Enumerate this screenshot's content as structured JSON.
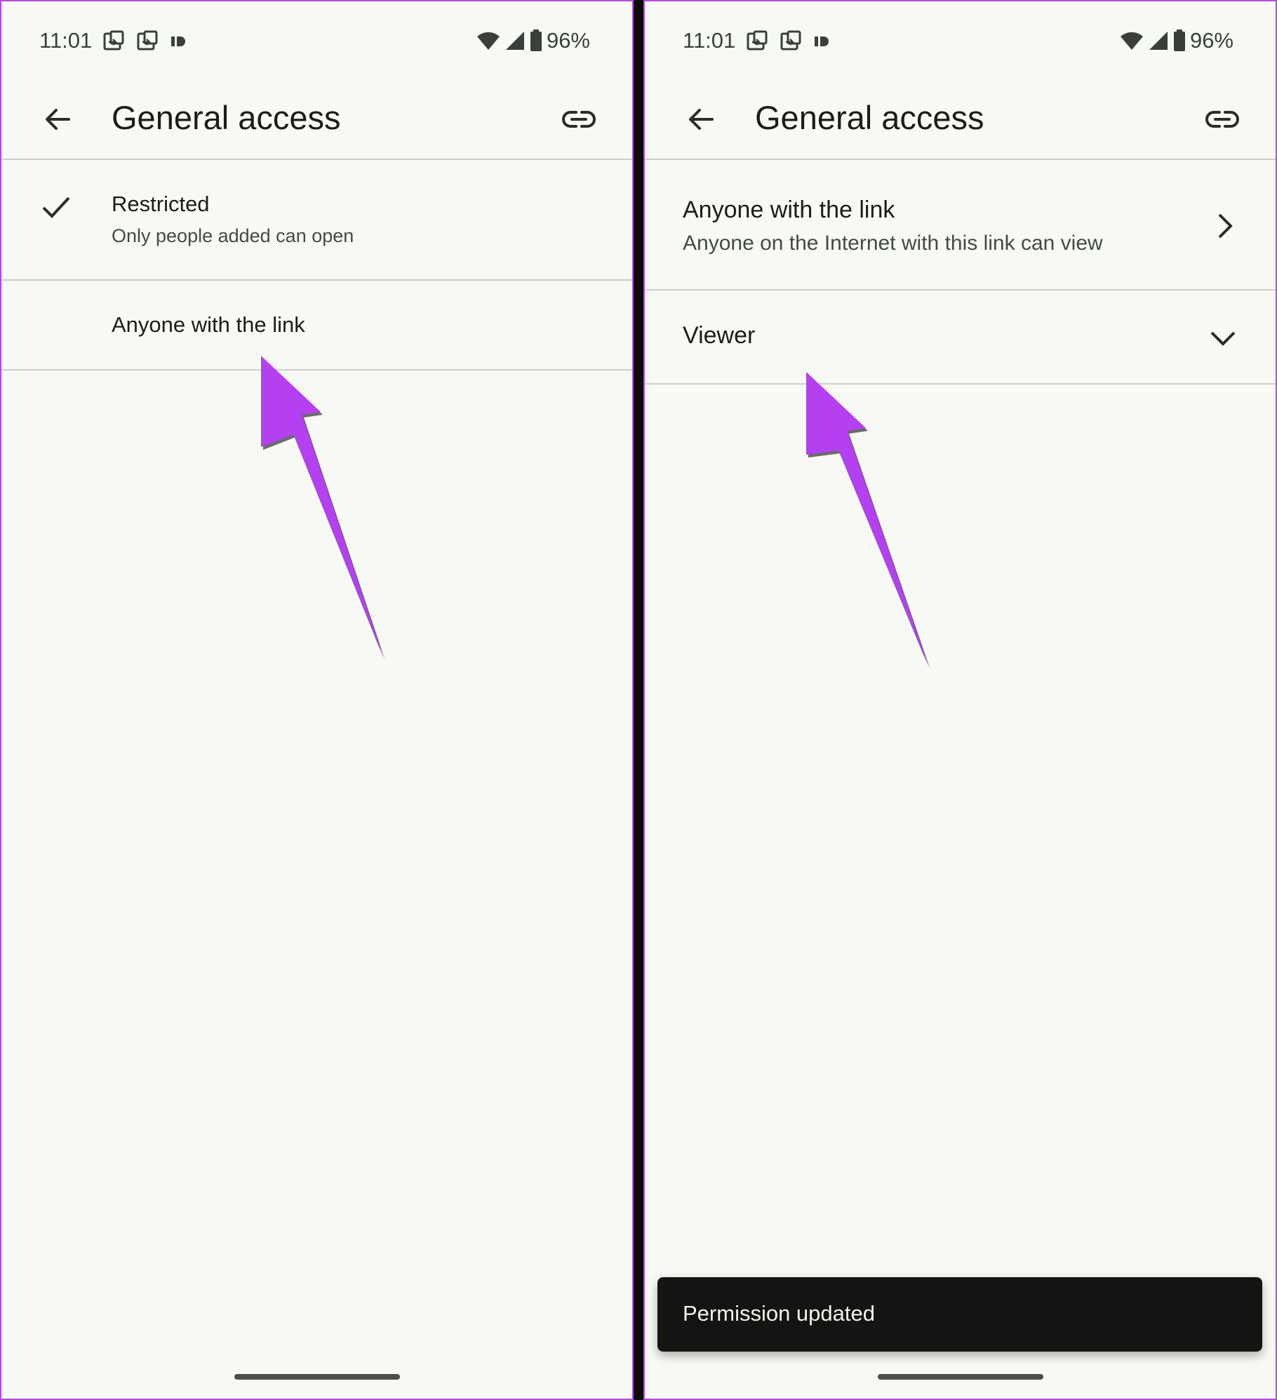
{
  "status_bar": {
    "time": "11:01",
    "battery": "96%",
    "icons": [
      "screen-share-icon",
      "screen-share-icon",
      "id-icon",
      "wifi-icon",
      "signal-icon",
      "battery-icon"
    ]
  },
  "left_screen": {
    "title": "General access",
    "options": [
      {
        "title": "Restricted",
        "subtitle": "Only people added can open",
        "selected": true
      },
      {
        "title": "Anyone with the link"
      }
    ]
  },
  "right_screen": {
    "title": "General access",
    "access_option": {
      "title": "Anyone with the link",
      "subtitle": "Anyone on the Internet with this link can view"
    },
    "role_dropdown": {
      "value": "Viewer"
    },
    "snackbar": {
      "message": "Permission updated"
    }
  },
  "colors": {
    "annotation_arrow": "#b440f2",
    "frame_border": "#b44be1",
    "screen_background": "#f7f9f4",
    "snackbar_background": "#121512"
  }
}
